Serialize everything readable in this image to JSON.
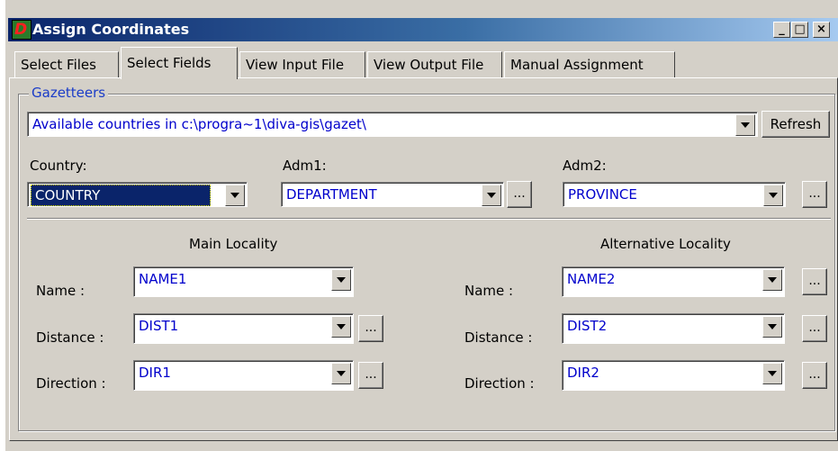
{
  "window": {
    "title": "Assign Coordinates",
    "minimize": "_",
    "restore": "□",
    "close": "×"
  },
  "tabs": [
    "Select Files",
    "Select Fields",
    "View Input File",
    "View Output File",
    "Manual Assignment"
  ],
  "gazetteers": {
    "label": "Gazetteers",
    "source_value": "Available countries in c:\\progra~1\\diva-gis\\gazet\\",
    "refresh_label": "Refresh",
    "country": {
      "label": "Country:",
      "value": "COUNTRY"
    },
    "adm1": {
      "label": "Adm1:",
      "value": "DEPARTMENT"
    },
    "adm2": {
      "label": "Adm2:",
      "value": "PROVINCE"
    }
  },
  "main_locality": {
    "heading": "Main Locality",
    "name": {
      "label": "Name :",
      "value": "NAME1"
    },
    "distance": {
      "label": "Distance :",
      "value": "DIST1"
    },
    "direction": {
      "label": "Direction :",
      "value": "DIR1"
    }
  },
  "alt_locality": {
    "heading": "Alternative Locality",
    "name": {
      "label": "Name :",
      "value": "NAME2"
    },
    "distance": {
      "label": "Distance :",
      "value": "DIST2"
    },
    "direction": {
      "label": "Direction :",
      "value": "DIR2"
    }
  },
  "ellipsis": "...",
  "colors": {
    "titlebar": "#0a246a",
    "accent_text": "#0000cc",
    "face": "#d4d0c8"
  }
}
